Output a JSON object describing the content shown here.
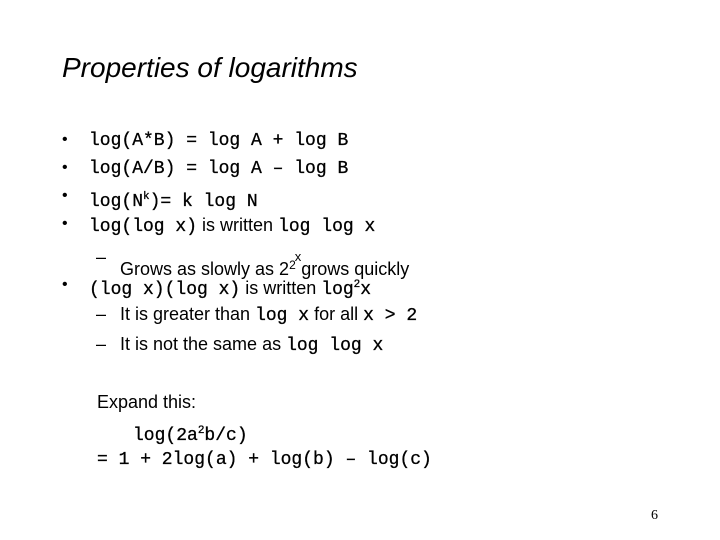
{
  "slide": {
    "title": "Properties of logarithms",
    "page_number": "6",
    "bullet_glyph": "•",
    "dash_glyph": "–",
    "bullets": [
      {
        "code_a": "log(A*B) = log A + log B"
      },
      {
        "code_a": "log(A/B) = log A – log B"
      },
      {
        "code_a": "log(N",
        "sup": "k",
        "code_b": ")= k log N"
      },
      {
        "code_a": "log(log x)",
        "text": " is written ",
        "code_b": "log log x"
      },
      {
        "code_a": "(log x)(log x)",
        "text": " is written ",
        "code_b": "log",
        "sup": "2",
        "code_c": "x"
      }
    ],
    "sub_bullets": {
      "grows": {
        "text_a": "Grows as slowly as 2",
        "sup": "2",
        "supx": "x",
        "text_b": "grows quickly"
      },
      "greater": {
        "text_a": "It is greater than ",
        "code_a": "log x",
        "text_b": " for all ",
        "code_b": "x > 2"
      },
      "not_same": {
        "text_a": "It is not the same as ",
        "code_a": "log log x"
      }
    },
    "exercise": {
      "label": "Expand this:",
      "expr_a": "log(2a",
      "expr_sup": "2",
      "expr_b": "b/c)",
      "answer": "= 1 + 2log(a) + log(b) – log(c)"
    }
  }
}
